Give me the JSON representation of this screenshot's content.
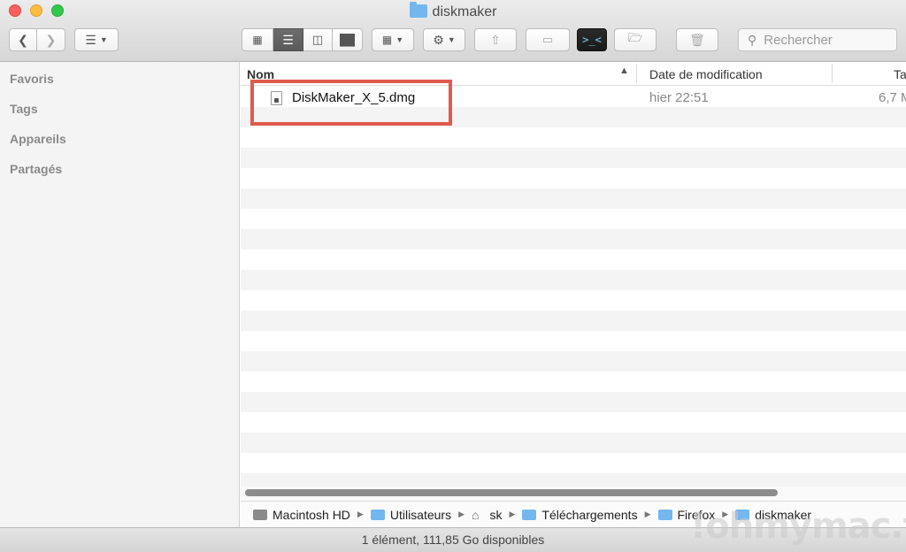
{
  "window": {
    "title": "diskmaker"
  },
  "search": {
    "placeholder": "Rechercher"
  },
  "sidebar": {
    "items": [
      {
        "label": "Favoris"
      },
      {
        "label": "Tags"
      },
      {
        "label": "Appareils"
      },
      {
        "label": "Partagés"
      }
    ]
  },
  "columns": {
    "name": "Nom",
    "modified": "Date de modification",
    "size": "Ta"
  },
  "files": [
    {
      "name": "DiskMaker_X_5.dmg",
      "modified": "hier 22:51",
      "size": "6,7 M"
    }
  ],
  "path": {
    "items": [
      {
        "label": "Macintosh HD",
        "icon": "hard-drive-icon"
      },
      {
        "label": "Utilisateurs",
        "icon": "folder-icon"
      },
      {
        "label": "sk",
        "icon": "home-icon"
      },
      {
        "label": "Téléchargements",
        "icon": "downloads-folder-icon"
      },
      {
        "label": "Firefox",
        "icon": "folder-icon"
      },
      {
        "label": "diskmaker",
        "icon": "folder-icon"
      }
    ]
  },
  "status": {
    "text": "1 élément, 111,85 Go disponibles"
  },
  "watermark": {
    "text": "!ohmymac.fr"
  },
  "colors": {
    "highlight": "#e05a4f",
    "folder": "#73b7ee"
  }
}
